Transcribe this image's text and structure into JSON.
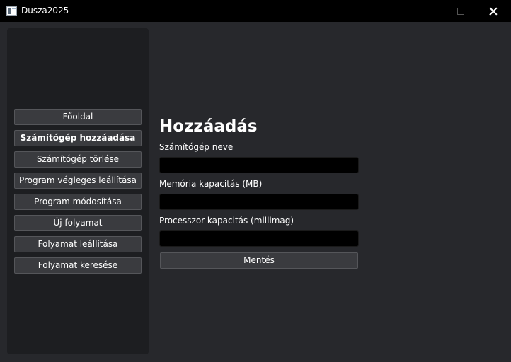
{
  "window": {
    "title": "Dusza2025",
    "icon": "app-window-icon"
  },
  "sidebar": {
    "items": [
      {
        "label": "Főoldal",
        "active": false
      },
      {
        "label": "Számítógép hozzáadása",
        "active": true
      },
      {
        "label": "Számítógép törlése",
        "active": false
      },
      {
        "label": "Program végleges leállítása",
        "active": false
      },
      {
        "label": "Program módosítása",
        "active": false
      },
      {
        "label": "Új folyamat",
        "active": false
      },
      {
        "label": "Folyamat leállítása",
        "active": false
      },
      {
        "label": "Folyamat keresése",
        "active": false
      }
    ]
  },
  "main": {
    "heading": "Hozzáadás",
    "fields": [
      {
        "label": "Számítógép neve",
        "value": "",
        "placeholder": ""
      },
      {
        "label": "Memória kapacitás (MB)",
        "value": "",
        "placeholder": ""
      },
      {
        "label": "Processzor kapacitás (millimag)",
        "value": "",
        "placeholder": ""
      }
    ],
    "save_label": "Mentés"
  },
  "colors": {
    "background": "#27282c",
    "sidebar": "#1d1e21",
    "titlebar": "#000000",
    "button": "#3a3b3f",
    "input": "#000000"
  }
}
